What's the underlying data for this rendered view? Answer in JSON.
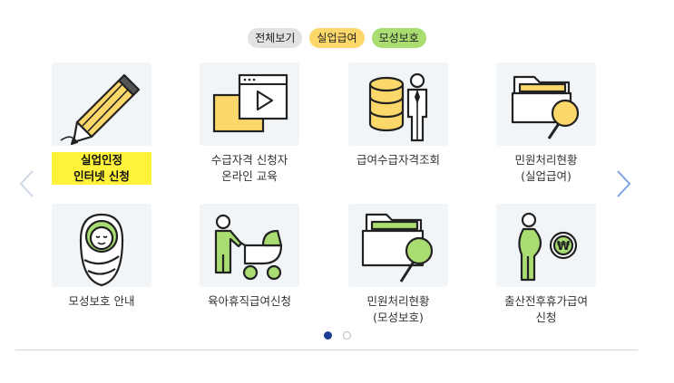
{
  "filters": [
    {
      "label": "전체보기",
      "color": "#e2e2e2"
    },
    {
      "label": "실업급여",
      "color": "#fbd869"
    },
    {
      "label": "모성보호",
      "color": "#a9dc71"
    }
  ],
  "tiles": [
    {
      "lines": [
        "실업인정",
        "인터넷 신청"
      ],
      "icon": "pencil-icon",
      "highlighted": true
    },
    {
      "lines": [
        "수급자격 신청자",
        "온라인 교육"
      ],
      "icon": "video-play-icon"
    },
    {
      "lines": [
        "급여수급자격조회"
      ],
      "icon": "database-person-icon"
    },
    {
      "lines": [
        "민원처리현황",
        "(실업급여)"
      ],
      "icon": "folder-search-icon"
    },
    {
      "lines": [
        "모성보호 안내"
      ],
      "icon": "baby-icon"
    },
    {
      "lines": [
        "육아휴직급여신청"
      ],
      "icon": "stroller-icon"
    },
    {
      "lines": [
        "민원처리현황",
        "(모성보호)"
      ],
      "icon": "folder-search-icon"
    },
    {
      "lines": [
        "출산전후휴가급여",
        "신청"
      ],
      "icon": "pregnant-coin-icon"
    }
  ],
  "pagination": {
    "current": 1,
    "total": 2
  },
  "colors": {
    "accent_yellow": "#fbd869",
    "accent_green": "#a9dc71",
    "highlight": "#fff23a",
    "active_dot": "#1a3f95"
  }
}
